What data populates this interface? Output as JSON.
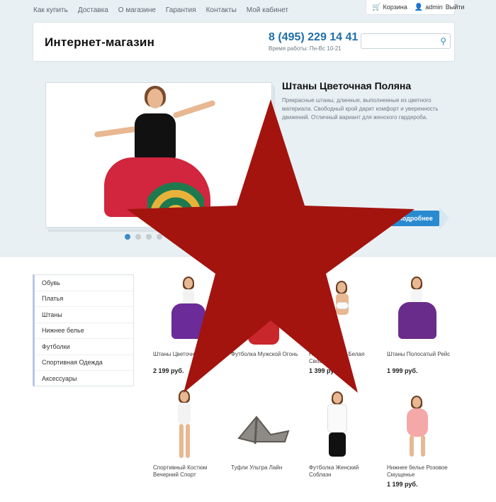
{
  "topnav": [
    "Как купить",
    "Доставка",
    "О магазине",
    "Гарантия",
    "Контакты",
    "Мой кабинет"
  ],
  "userbar": {
    "cart_label": "Корзина",
    "user_label": "admin",
    "logout_label": "Выйти"
  },
  "header": {
    "logo": "Интернет-магазин",
    "phone": "8 (495) 229 14 41",
    "hours": "Время работы: Пн-Вс 10-21",
    "search_placeholder": ""
  },
  "slider": {
    "title": "Штаны Цветочная Поляна",
    "description": "Прекрасные штаны, длинные, выполненные из цветного материала. Свободный крой дарит комфорт и уверенность движений. Отличный вариант для женского гардероба.",
    "more_label": "Подробнее",
    "dots_count": 5,
    "active_dot": 1
  },
  "sidebar": {
    "items": [
      "Обувь",
      "Платья",
      "Штаны",
      "Нижнее белье",
      "Футболки",
      "Спортивная Одежда",
      "Аксессуары"
    ]
  },
  "products": [
    {
      "name": "Штаны Цветочная Поляна",
      "price": "2 199 руб."
    },
    {
      "name": "Футболка Мужской Огонь",
      "price": ""
    },
    {
      "name": "Нижнее белье Белая Свобода",
      "price": "1 399 руб."
    },
    {
      "name": "Штаны Полосатый Рейс",
      "price": "1 999 руб."
    },
    {
      "name": "Спортивный Костюм Вечерний Спорт",
      "price": ""
    },
    {
      "name": "Туфли Ультра Лайн",
      "price": ""
    },
    {
      "name": "Футболка Женский Соблазн",
      "price": ""
    },
    {
      "name": "Нижнее белье Розовое Смущенье",
      "price": "1 199 руб."
    }
  ],
  "colors": {
    "accent": "#2a8ad0",
    "phone": "#1f6fa8",
    "star": "#a3140f",
    "background_top": "#e9f0f4"
  },
  "icons": {
    "cart": "cart-icon",
    "user": "user-icon",
    "search": "search-icon"
  }
}
